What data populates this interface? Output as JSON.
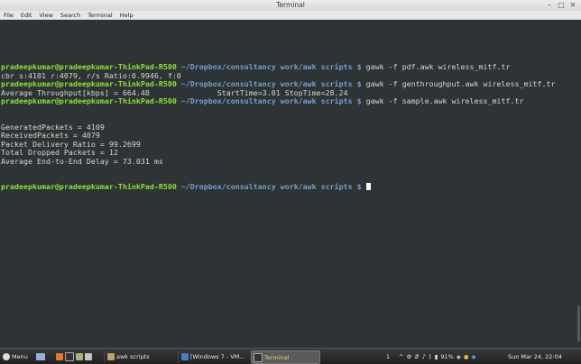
{
  "window": {
    "title": "Terminal",
    "controls": [
      "–",
      "□",
      "✕"
    ]
  },
  "menu": [
    "File",
    "Edit",
    "View",
    "Search",
    "Terminal",
    "Help"
  ],
  "prompt": {
    "user": "pradeepkumar@pradeepkumar-ThinkPad-R500",
    "path": "~/Dropbox/consultancy work/awk scripts",
    "symbol": "$"
  },
  "lines": {
    "cmd1": "gawk -f pdf.awk wireless_mitf.tr",
    "out1": "cbr s:4101 r:4079, r/s Ratio:0.9946, f:0",
    "cmd2": "gawk -f genthroughput.awk wireless_mitf.tr",
    "out2": "Average Throughput[kbps] = 664.48               StartTime=3.01 StopTime=28.24",
    "cmd3": "gawk -f sample.awk wireless_mitf.tr",
    "out3": "GeneratedPackets = 4109",
    "out4": "ReceivedPackets = 4079",
    "out5": "Packet Delivery Ratio = 99.2699",
    "out6": "Total Dropped Packets = 12",
    "out7": "Average End-to-End Delay = 73.031 ms"
  },
  "taskbar": {
    "menu_label": "Menu",
    "folder_label": "awk scripts",
    "vm_label": "[Windows 7 - VM...",
    "terminal_label": "Terminal",
    "workspace": "1",
    "battery": "91%",
    "clock": "Sun Mar 24, 22:04"
  }
}
